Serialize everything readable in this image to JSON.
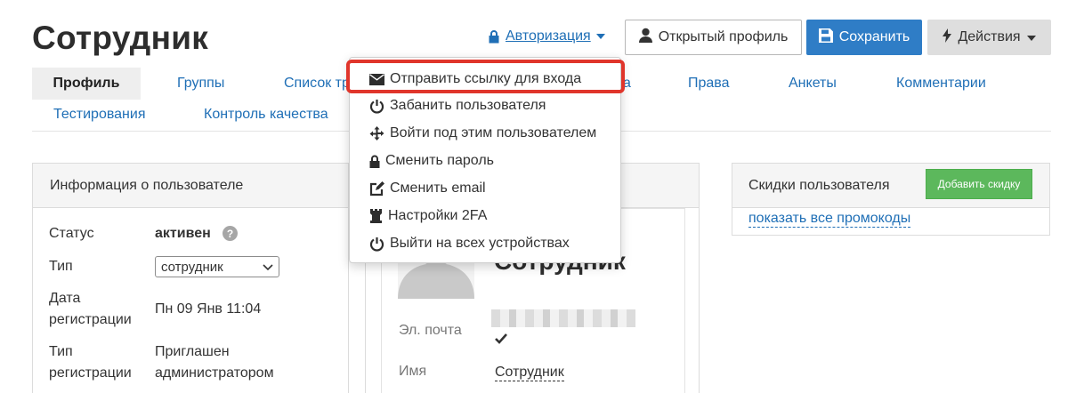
{
  "header": {
    "title": "Сотрудник",
    "auth_label": "Авторизация",
    "profile_button": "Открытый профиль",
    "save_button": "Сохранить",
    "actions_button": "Действия"
  },
  "tabs": [
    {
      "label": "Профиль"
    },
    {
      "label": "Группы"
    },
    {
      "label": "Список тр"
    },
    {
      "label": "а"
    },
    {
      "label": "Права"
    },
    {
      "label": "Анкеты"
    },
    {
      "label": "Комментарии"
    },
    {
      "label": "Тестирования"
    },
    {
      "label": "Контроль качества"
    }
  ],
  "info_panel": {
    "title": "Информация о пользователе",
    "status_label": "Статус",
    "status_value": "активен",
    "type_label": "Тип",
    "type_select_value": "сотрудник",
    "reg_date_label_1": "Дата",
    "reg_date_label_2": "регистрации",
    "reg_date_value": "Пн 09 Янв 11:04",
    "reg_type_label_1": "Тип",
    "reg_type_label_2": "регистрации",
    "reg_type_value_1": "Приглашен",
    "reg_type_value_2": "администратором"
  },
  "profile_card": {
    "name_heading": "Сотрудник",
    "email_label": "Эл. почта",
    "name_label": "Имя",
    "name_value": "Сотрудник"
  },
  "discounts_panel": {
    "title": "Скидки пользователя",
    "add_button": "Добавить скидку",
    "show_promos_link": "показать все промокоды"
  },
  "dropdown_menu": {
    "items": [
      {
        "label": "Отправить ссылку для входа",
        "icon": "envelope-icon"
      },
      {
        "label": "Забанить пользователя",
        "icon": "power-icon"
      },
      {
        "label": "Войти под этим пользователем",
        "icon": "move-icon"
      },
      {
        "label": "Сменить пароль",
        "icon": "lock-icon"
      },
      {
        "label": "Сменить email",
        "icon": "edit-icon"
      },
      {
        "label": "Настройки 2FA",
        "icon": "tower-icon"
      },
      {
        "label": "Выйти на всех устройствах",
        "icon": "power-icon"
      }
    ]
  },
  "colors": {
    "link": "#1f6fb6",
    "save_button": "#2f7dc6",
    "add_discount_button": "#5cb85c",
    "highlight_border": "#e0352b"
  }
}
